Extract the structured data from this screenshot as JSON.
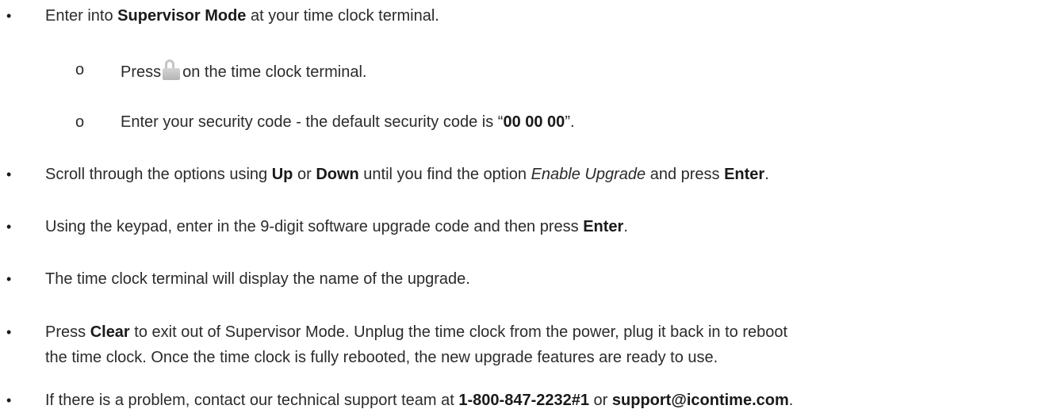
{
  "bullet_char": "•",
  "sub_marker_char": "o",
  "steps": {
    "step1": {
      "pre": "Enter into ",
      "bold": "Supervisor Mode",
      "post": " at your time clock terminal."
    },
    "step1_sub1": {
      "pre": "Press",
      "icon": "lock-icon",
      "post": "on the time clock terminal."
    },
    "step1_sub2": {
      "pre": "Enter your security code - the default security code is “",
      "bold": "00 00 00",
      "post": "”."
    },
    "step2": {
      "pre": "Scroll through the options using ",
      "bold1": "Up",
      "mid1": " or ",
      "bold2": "Down",
      "mid2": " until you find the option ",
      "italic": "Enable Upgrade",
      "mid3": " and press ",
      "bold3": "Enter",
      "post": "."
    },
    "step3": {
      "pre": "Using the keypad, enter in the 9-digit software upgrade code and then press ",
      "bold": "Enter",
      "post": "."
    },
    "step4": {
      "text": "The time clock terminal will display the name of the upgrade."
    },
    "step5": {
      "pre": "Press ",
      "bold": "Clear",
      "post": " to exit out of Supervisor Mode. Unplug the time clock from the power, plug it back in to reboot",
      "line2": "the time clock. Once the time clock is fully rebooted, the new upgrade features are ready to use."
    },
    "step6": {
      "pre": "If there is a problem, contact our technical support team at ",
      "phone": "1-800-847-2232#1",
      "mid": " or ",
      "email": "support@icontime.com",
      "post": "."
    }
  }
}
